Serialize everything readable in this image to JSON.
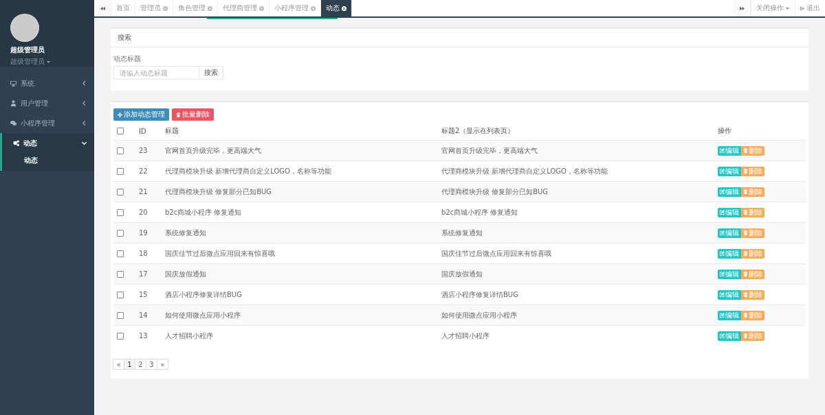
{
  "profile": {
    "name": "超级管理员",
    "role": "超级管理员"
  },
  "sidebar": {
    "items": [
      {
        "label": "系统",
        "kind": "monitor",
        "expanded": false
      },
      {
        "label": "用户管理",
        "kind": "user",
        "expanded": false
      },
      {
        "label": "小程序管理",
        "kind": "chat",
        "expanded": false
      },
      {
        "label": "动态",
        "kind": "gears",
        "expanded": true,
        "children": [
          {
            "label": "动态",
            "selected": true
          }
        ]
      }
    ]
  },
  "tabs": [
    {
      "label": "首页",
      "closable": false,
      "selected": false
    },
    {
      "label": "管理员",
      "closable": true,
      "selected": false
    },
    {
      "label": "角色管理",
      "closable": true,
      "selected": false
    },
    {
      "label": "代理商管理",
      "closable": true,
      "selected": false
    },
    {
      "label": "小程序管理",
      "closable": true,
      "selected": false
    },
    {
      "label": "动态",
      "closable": true,
      "selected": true
    }
  ],
  "top_actions": {
    "close_menu": "关闭操作",
    "logout": "退出"
  },
  "search": {
    "title": "搜索",
    "field_label": "动态标题",
    "placeholder": "请输入动态标题",
    "button": "搜索"
  },
  "toolbar": {
    "add": "添加动态管理",
    "batch_delete": "批量删除"
  },
  "table": {
    "select_all": {
      "checked": false
    },
    "columns": [
      "ID",
      "标题",
      "标题2（显示在列表页）",
      "操作"
    ],
    "rows": [
      {
        "checked": false,
        "id": "23",
        "title": "官网首页升级完毕，更高端大气",
        "title2": "官网首页升级完毕，更高端大气",
        "edit": "编辑",
        "delete": "删除"
      },
      {
        "checked": false,
        "id": "22",
        "title": "代理商模块升级 新增代理商自定义LOGO，名称等功能",
        "title2": "代理商模块升级 新增代理商自定义LOGO，名称等功能",
        "edit": "编辑",
        "delete": "删除"
      },
      {
        "checked": false,
        "id": "21",
        "title": "代理商模块升级 修复部分已知BUG",
        "title2": "代理商模块升级 修复部分已知BUG",
        "edit": "编辑",
        "delete": "删除"
      },
      {
        "checked": false,
        "id": "20",
        "title": "b2c商城小程序 修复通知",
        "title2": "b2c商城小程序 修复通知",
        "edit": "编辑",
        "delete": "删除"
      },
      {
        "checked": false,
        "id": "19",
        "title": "系统修复通知",
        "title2": "系统修复通知",
        "edit": "编辑",
        "delete": "删除"
      },
      {
        "checked": false,
        "id": "18",
        "title": "国庆佳节过后微点应用回来有惊喜哦",
        "title2": "国庆佳节过后微点应用回来有惊喜哦",
        "edit": "编辑",
        "delete": "删除"
      },
      {
        "checked": false,
        "id": "17",
        "title": "国庆放假通知",
        "title2": "国庆放假通知",
        "edit": "编辑",
        "delete": "删除"
      },
      {
        "checked": false,
        "id": "15",
        "title": "酒店小程序修复详情BUG",
        "title2": "酒店小程序修复详情BUG",
        "edit": "编辑",
        "delete": "删除"
      },
      {
        "checked": false,
        "id": "14",
        "title": "如何使用微点应用小程序",
        "title2": "如何使用微点应用小程序",
        "edit": "编辑",
        "delete": "删除"
      },
      {
        "checked": false,
        "id": "13",
        "title": "人才招聘小程序",
        "title2": "人才招聘小程序",
        "edit": "编辑",
        "delete": "删除"
      }
    ]
  },
  "pagination": [
    {
      "label": "«",
      "selected": false
    },
    {
      "label": "1",
      "selected": true
    },
    {
      "label": "2",
      "selected": false
    },
    {
      "label": "3",
      "selected": false
    },
    {
      "label": "»",
      "selected": false
    }
  ]
}
